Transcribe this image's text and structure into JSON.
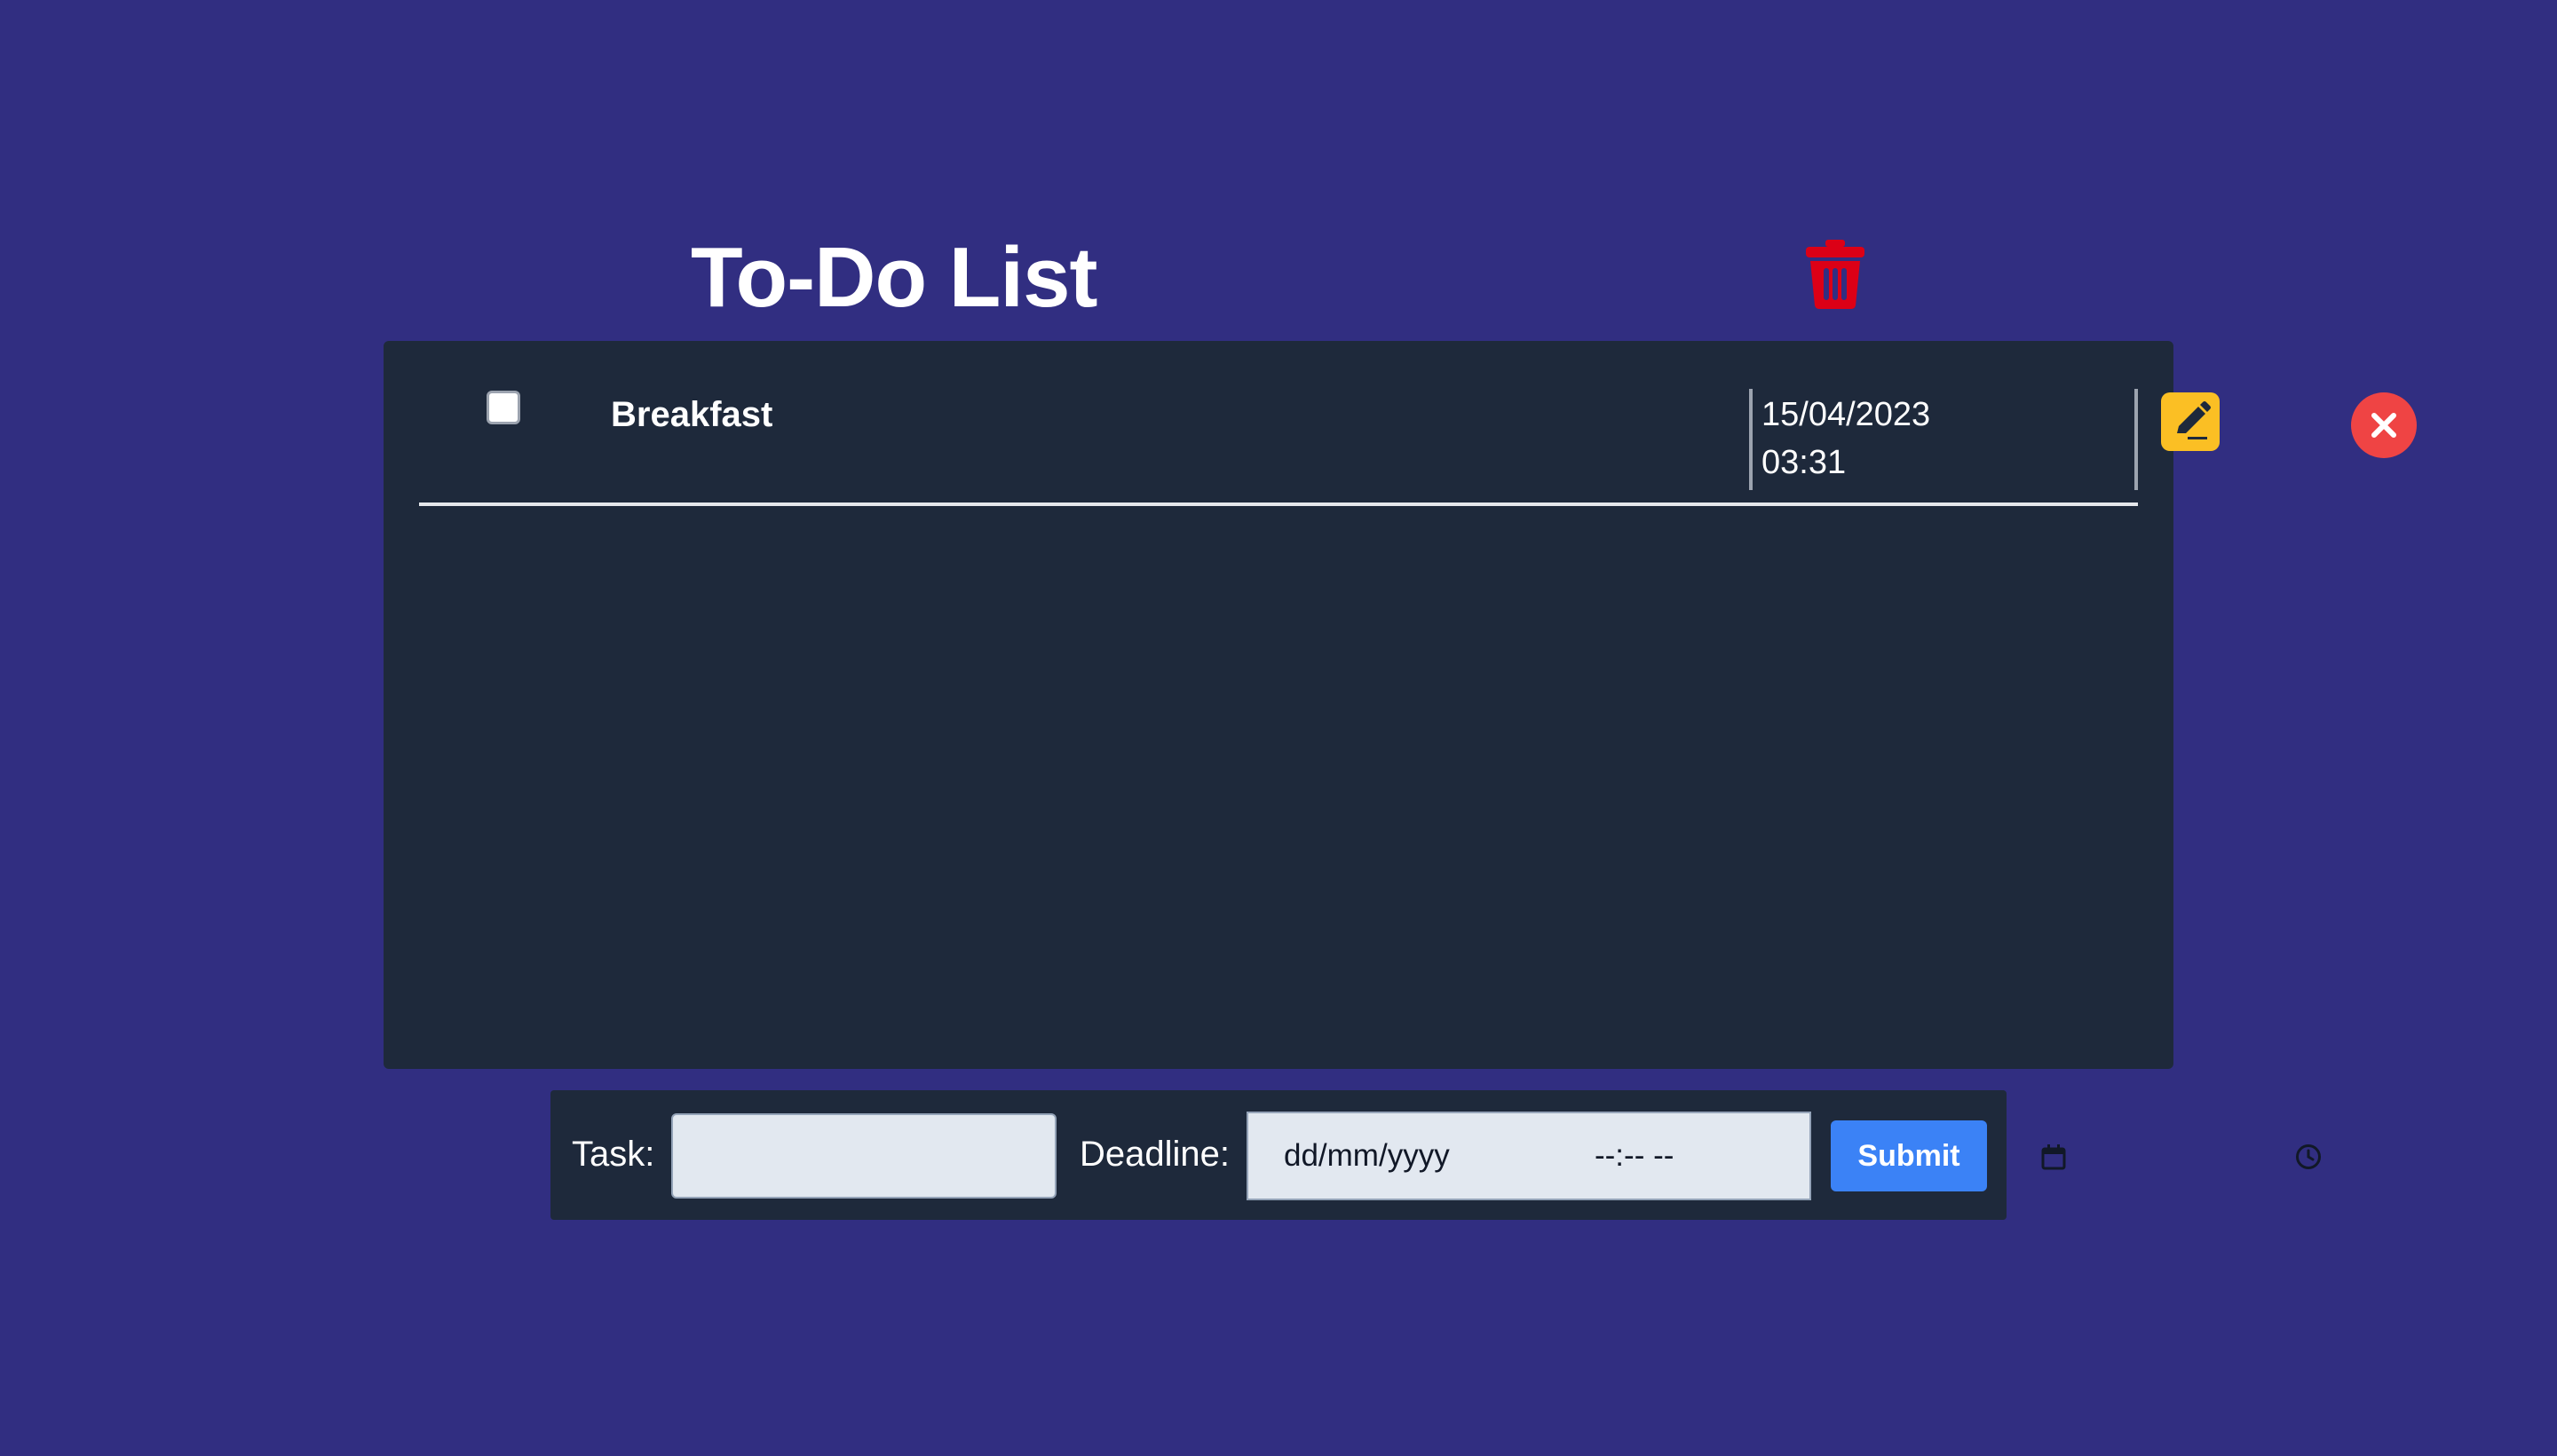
{
  "header": {
    "title": "To-Do List",
    "clear_all_icon": "trash-icon"
  },
  "tasks": [
    {
      "name": "Breakfast",
      "completed": false,
      "deadline_date": "15/04/2023",
      "deadline_time": "03:31",
      "edit_icon": "pencil-icon",
      "delete_icon": "close-circle-icon"
    }
  ],
  "form": {
    "task_label": "Task:",
    "task_value": "",
    "deadline_label": "Deadline:",
    "date_placeholder": "dd/mm/yyyy",
    "time_placeholder": "--:-- --",
    "submit_label": "Submit"
  },
  "colors": {
    "background": "#312e81",
    "panel": "#1e293b",
    "trash": "#dc0016",
    "edit": "#fbbf24",
    "delete": "#ef4444",
    "submit": "#3b82f6"
  }
}
